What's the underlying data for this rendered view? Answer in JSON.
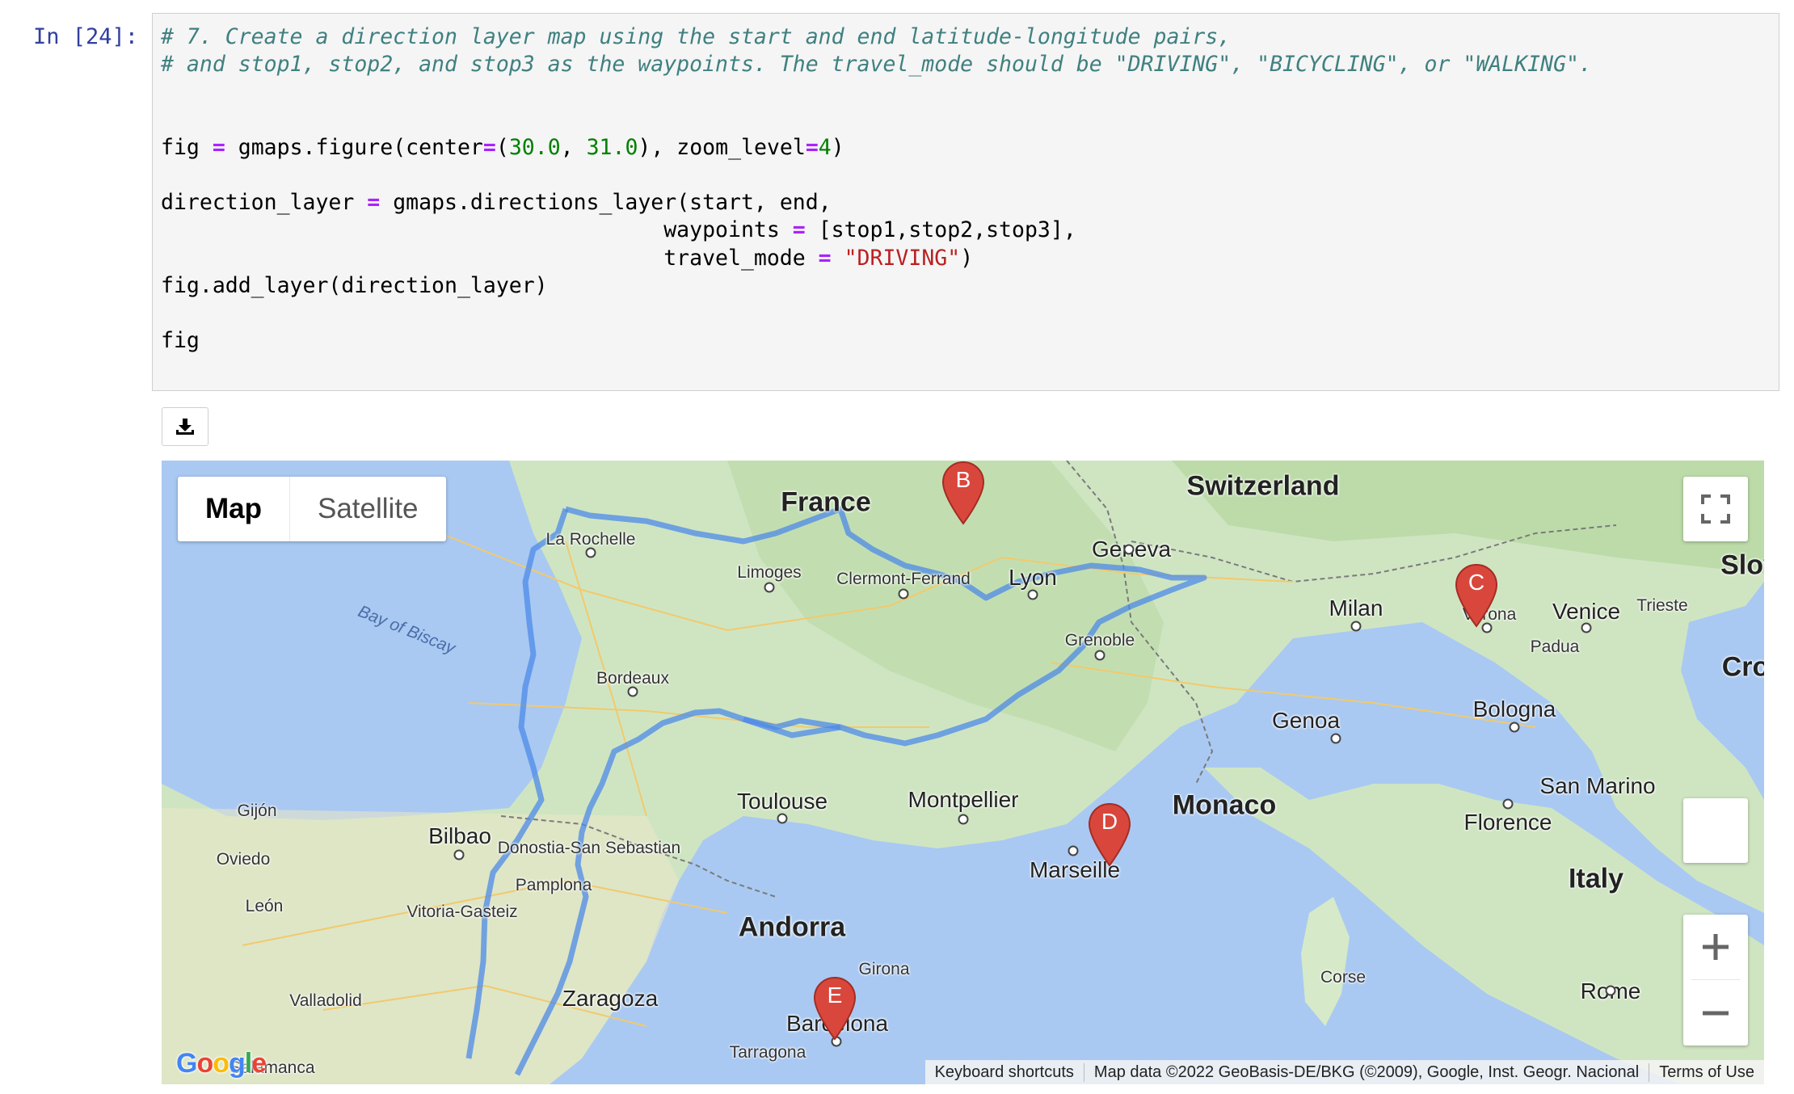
{
  "cell": {
    "prompt": "In [24]:",
    "code": {
      "comment1": "# 7. Create a direction layer map using the start and end latitude-longitude pairs,",
      "comment2": "# and stop1, stop2, and stop3 as the waypoints. The travel_mode should be \"DRIVING\", \"BICYCLING\", or \"WALKING\".",
      "l1_a": "fig ",
      "l1_op1": "=",
      "l1_b": " gmaps.figure(center",
      "l1_op2": "=",
      "l1_c": "(",
      "l1_n1": "30.0",
      "l1_d": ", ",
      "l1_n2": "31.0",
      "l1_e": "), zoom_level",
      "l1_op3": "=",
      "l1_n3": "4",
      "l1_f": ")",
      "l2_a": "direction_layer ",
      "l2_op": "=",
      "l2_b": " gmaps.directions_layer(start, end,",
      "l3_a": "                                       waypoints ",
      "l3_op": "=",
      "l3_b": " [stop1,stop2,stop3],",
      "l4_a": "                                       travel_mode ",
      "l4_op": "=",
      "l4_s": " \"DRIVING\"",
      "l4_b": ")",
      "l5": "fig.add_layer(direction_layer)",
      "l6": "fig"
    }
  },
  "map": {
    "map_type_buttons": [
      "Map",
      "Satellite"
    ],
    "selected_map_type": "Map",
    "markers": [
      "B",
      "C",
      "D",
      "E"
    ],
    "route_color": "#4d8ae8",
    "marker_color": "#d9473c",
    "labels": {
      "france": "France",
      "switzerland": "Switzerland",
      "slov": "Slov",
      "cro": "Cro",
      "la_rochelle": "La Rochelle",
      "limoges": "Limoges",
      "clermont": "Clermont-Ferrand",
      "lyon": "Lyon",
      "geneva": "Geneva",
      "milan": "Milan",
      "verona": "Verona",
      "venice": "Venice",
      "trieste": "Trieste",
      "padua": "Padua",
      "grenoble": "Grenoble",
      "bay": "Bay of Biscay",
      "bordeaux": "Bordeaux",
      "genoa": "Genoa",
      "bologna": "Bologna",
      "toulouse": "Toulouse",
      "montpellier": "Montpellier",
      "monaco": "Monaco",
      "san_marino": "San Marino",
      "florence": "Florence",
      "gijon": "Gijón",
      "oviedo": "Oviedo",
      "bilbao": "Bilbao",
      "donostia": "Donostia-San Sebastian",
      "pamplona": "Pamplona",
      "marseille": "Marseille",
      "italy": "Italy",
      "leon": "León",
      "vitoria": "Vitoria-Gasteiz",
      "andorra": "Andorra",
      "girona": "Girona",
      "corse": "Corse",
      "rome": "Rome",
      "valladolid": "Valladolid",
      "zaragoza": "Zaragoza",
      "barcelona": "Barcelona",
      "tarragona": "Tarragona",
      "salamanca": "Salamanca"
    },
    "attribution": [
      "Keyboard shortcuts",
      "Map data ©2022 GeoBasis-DE/BKG (©2009), Google, Inst. Geogr. Nacional",
      "Terms of Use"
    ],
    "logo": "Google"
  }
}
